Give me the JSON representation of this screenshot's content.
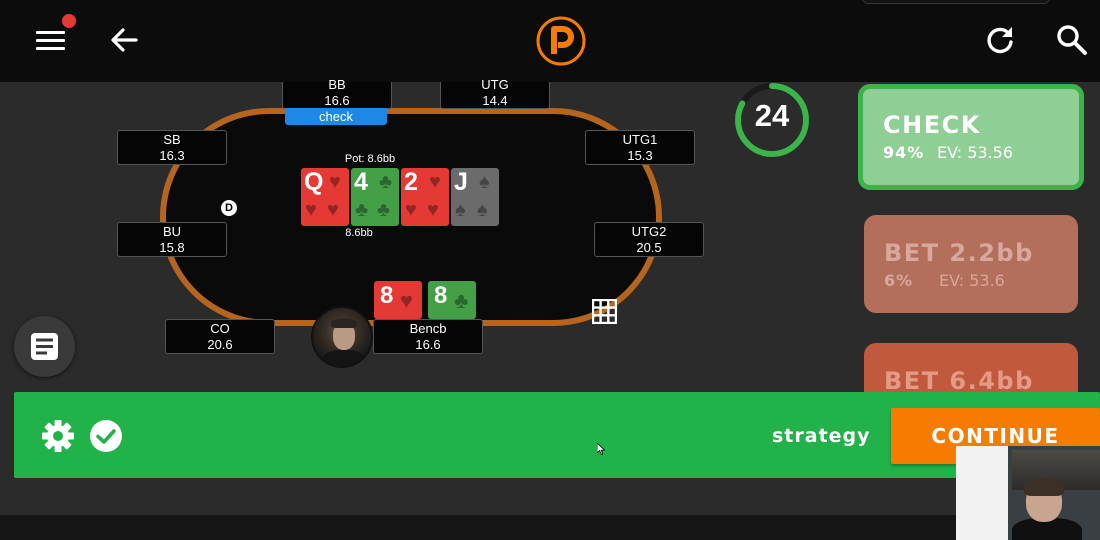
{
  "colors": {
    "topbar": "#0c0c0c",
    "background": "#2b2b2b",
    "table_rail": "#b5651d",
    "felt": "#0a0a0a",
    "check_tag": "#1e88e5",
    "bottom_bar": "#21b34a",
    "continue": "#f57c00",
    "check_action": "#8fce94",
    "check_border": "#3bb54a",
    "bet1_action": "#b36e5c",
    "bet2_action": "#c1593e",
    "card_hearts": "#e53935",
    "card_clubs": "#43a047",
    "card_spades": "#6b6b6b"
  },
  "topbar": {
    "menu_icon": "hamburger-menu-icon",
    "notification": "red-dot",
    "back_icon": "arrow-left-icon",
    "logo_letter": "P",
    "refresh_icon": "refresh-icon",
    "search_icon": "search-icon"
  },
  "table": {
    "pot_label": "Pot: 8.6bb",
    "pot_below": "8.6bb",
    "dealer_button": "D",
    "seats": [
      {
        "name": "BB",
        "stack": "16.6",
        "action": "check"
      },
      {
        "name": "UTG",
        "stack": "14.4"
      },
      {
        "name": "SB",
        "stack": "16.3"
      },
      {
        "name": "UTG1",
        "stack": "15.3"
      },
      {
        "name": "BU",
        "stack": "15.8"
      },
      {
        "name": "UTG2",
        "stack": "20.5"
      },
      {
        "name": "CO",
        "stack": "20.6"
      },
      {
        "name": "Bencb",
        "stack": "16.6"
      }
    ],
    "board": [
      {
        "rank": "Q",
        "suit": "hearts"
      },
      {
        "rank": "4",
        "suit": "clubs"
      },
      {
        "rank": "2",
        "suit": "hearts"
      },
      {
        "rank": "J",
        "suit": "spades"
      }
    ],
    "hero_hand": [
      {
        "rank": "8",
        "suit": "hearts"
      },
      {
        "rank": "8",
        "suit": "clubs"
      }
    ]
  },
  "timer": {
    "value": "24",
    "progress": 0.83
  },
  "actions": [
    {
      "label": "CHECK",
      "frequency": "94%",
      "ev": "EV: 53.56",
      "selected": true
    },
    {
      "label": "BET 2.2bb",
      "frequency": "6%",
      "ev": "EV: 53.6"
    },
    {
      "label": "BET 6.4bb"
    }
  ],
  "bottom_bar": {
    "settings_icon": "gear-icon",
    "confirm_icon": "check-circle-icon",
    "strategy_label": "strategy",
    "continue_label": "CONTINUE"
  }
}
